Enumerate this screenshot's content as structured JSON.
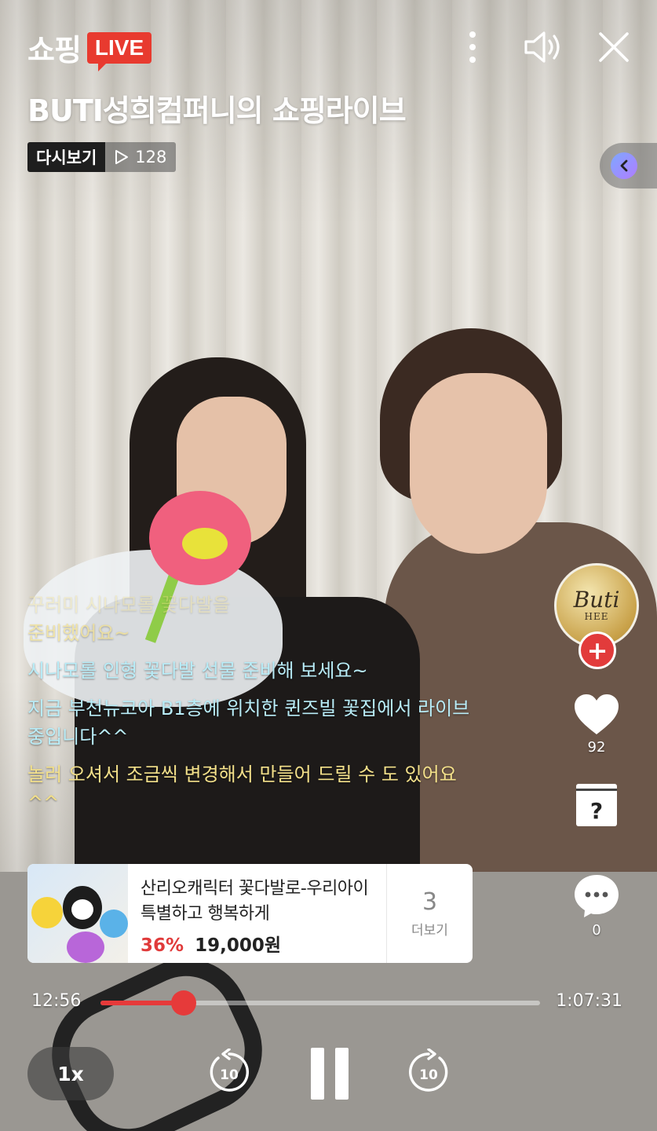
{
  "header": {
    "logo_text": "쇼핑",
    "logo_badge": "LIVE",
    "title": "BUTI성희컴퍼니의 쇼핑라이브",
    "replay_label": "다시보기",
    "views": "128",
    "icons": [
      "more-vertical-icon",
      "speaker-icon",
      "close-icon",
      "chevron-left-icon"
    ]
  },
  "chat": {
    "messages": [
      "꾸러미 시나모롤 꽃다발을",
      "준비했어요~",
      "시나모롤 인형 꽃다발 선물 준비해 보세요~",
      "지금 부천뉴코아 B1층에 위치한 퀸즈빌 꽃집에서 라이브 중입니다^^",
      "놀러 오셔서 조금씩 변경해서 만들어 드릴 수 도 있어요^^"
    ]
  },
  "rail": {
    "avatar_logo": "Buti",
    "avatar_sub": "HEE",
    "follow_symbol": "+",
    "likes": "92",
    "comments": "0",
    "qa_symbol": "?"
  },
  "product": {
    "name": "산리오캐릭터 꽃다발로-우리아이 특별하고 행복하게",
    "discount": "36%",
    "price": "19,000원",
    "more_count": "3",
    "more_label": "더보기"
  },
  "player": {
    "current_time": "12:56",
    "total_time": "1:07:31",
    "progress": 0.19,
    "speed": "1x",
    "rewind_seconds": "10",
    "forward_seconds": "10",
    "accent_color": "#e63a3a"
  }
}
